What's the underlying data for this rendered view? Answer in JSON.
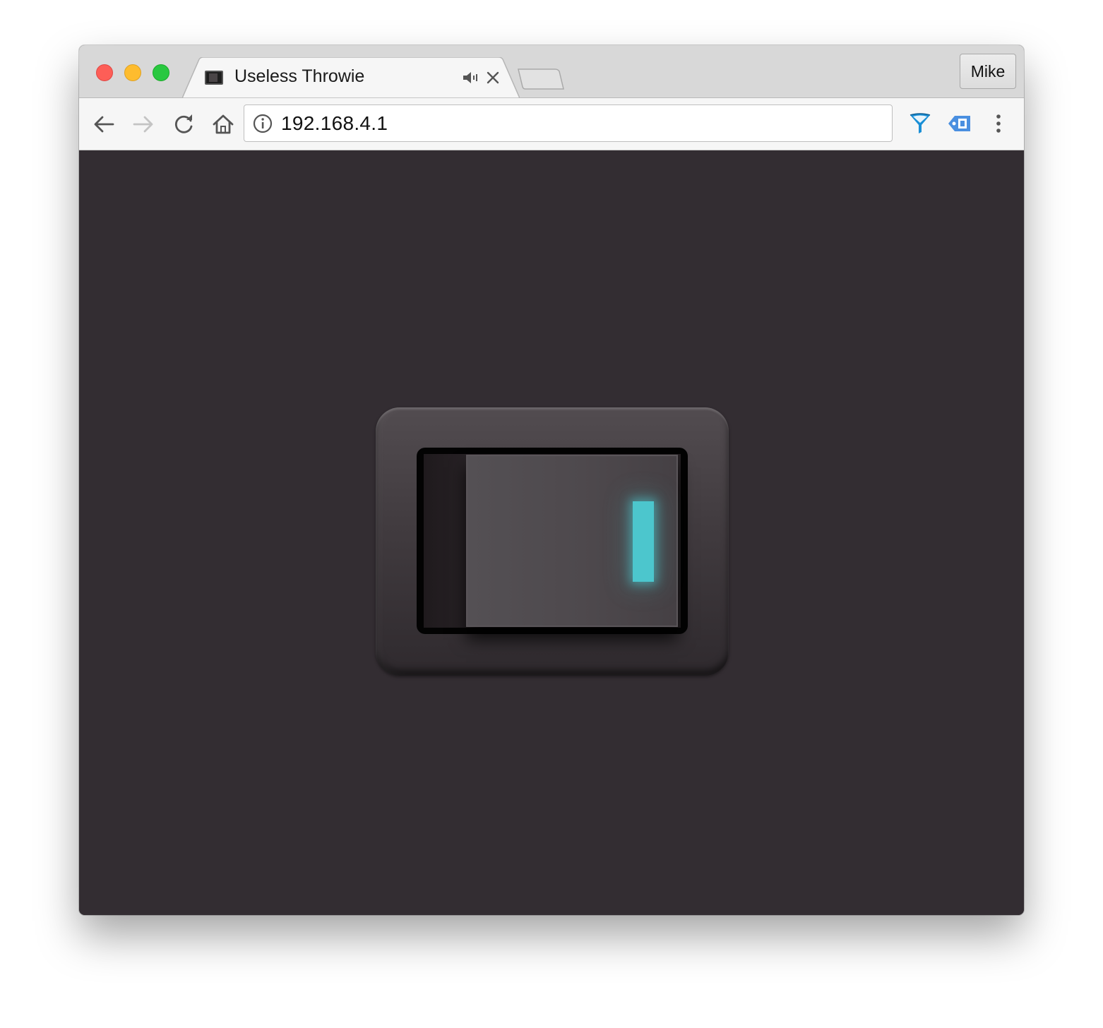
{
  "browser": {
    "tab": {
      "title": "Useless Throwie",
      "favicon": "page-favicon-icon",
      "audio_icon": "speaker-icon",
      "close_icon": "close-icon"
    },
    "profile_label": "Mike",
    "address_bar": {
      "url": "192.168.4.1",
      "info_icon": "info-icon"
    },
    "nav_icons": [
      "back-arrow-icon",
      "forward-arrow-icon",
      "reload-icon",
      "home-icon"
    ],
    "forward_enabled": false,
    "extension_icons": [
      "funnel-extension-icon",
      "tag-extension-icon"
    ],
    "menu_icon": "vertical-dots-menu-icon"
  },
  "page": {
    "background_color": "#332d32",
    "switch": {
      "state": "on",
      "indicator_color": "#4cc6cd"
    }
  }
}
